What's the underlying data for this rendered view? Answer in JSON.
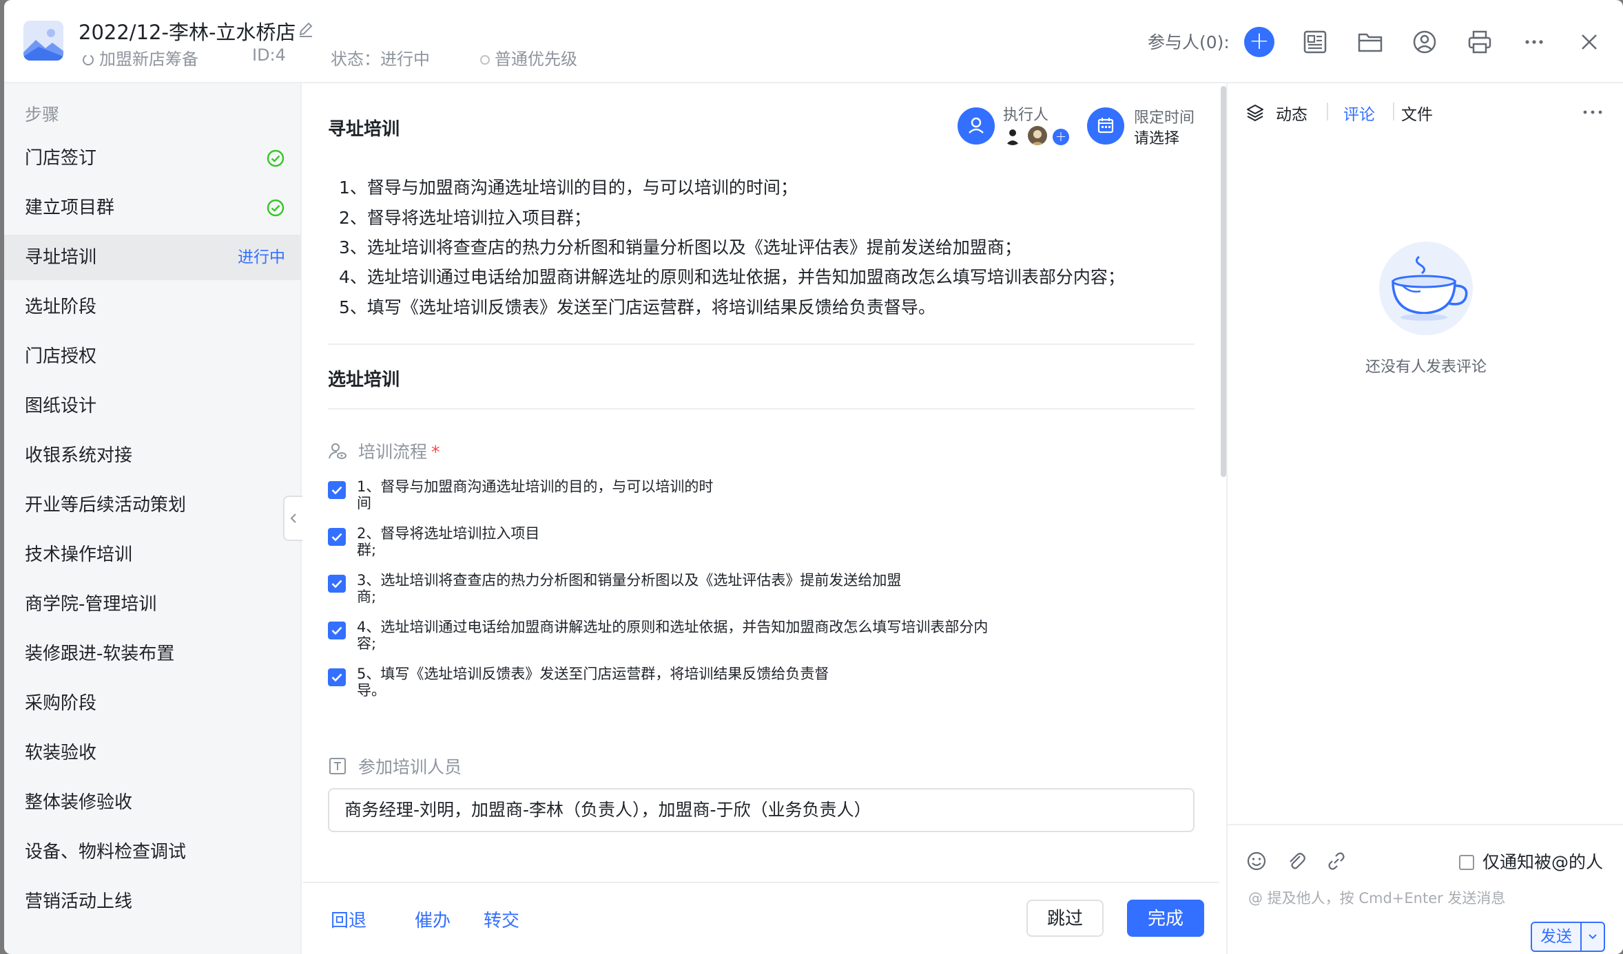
{
  "header": {
    "title": "2022/12-李林-立水桥店",
    "category": "加盟新店筹备",
    "id_text": "ID:4",
    "status_text": "状态：进行中",
    "priority": "普通优先级",
    "participants_label": "参与人(0):"
  },
  "sidebar": {
    "heading": "步骤",
    "steps": [
      {
        "label": "门店签订",
        "done": true
      },
      {
        "label": "建立项目群",
        "done": true
      },
      {
        "label": "寻址培训",
        "status": "进行中"
      },
      {
        "label": "选址阶段"
      },
      {
        "label": "门店授权"
      },
      {
        "label": "图纸设计"
      },
      {
        "label": "收银系统对接"
      },
      {
        "label": "开业等后续活动策划"
      },
      {
        "label": "技术操作培训"
      },
      {
        "label": "商学院-管理培训"
      },
      {
        "label": "装修跟进-软装布置"
      },
      {
        "label": "采购阶段"
      },
      {
        "label": "软装验收"
      },
      {
        "label": "整体装修验收"
      },
      {
        "label": "设备、物料检查调试"
      },
      {
        "label": "营销活动上线"
      }
    ]
  },
  "main": {
    "section1_title": "寻址培训",
    "executor_label": "执行人",
    "deadline_label": "限定时间",
    "deadline_value": "请选择",
    "description": [
      "1、督导与加盟商沟通选址培训的目的，与可以培训的时间；",
      "2、督导将选址培训拉入项目群；",
      "3、选址培训将查查店的热力分析图和销量分析图以及《选址评估表》提前发送给加盟商；",
      "4、选址培训通过电话给加盟商讲解选址的原则和选址依据，并告知加盟商改怎么填写培训表部分内容；",
      "5、填写《选址培训反馈表》发送至门店运营群，将培训结果反馈给负责督导。"
    ],
    "section2_title": "选址培训",
    "field_process_label": "培训流程",
    "required_mark": "*",
    "checklist": [
      {
        "text": "1、督导与加盟商沟通选址培训的目的，与可以培训的时\n间",
        "checked": true
      },
      {
        "text": "2、督导将选址培训拉入项目\n群;",
        "checked": true
      },
      {
        "text": "3、选址培训将查查店的热力分析图和销量分析图以及《选址评估表》提前发送给加盟\n商;",
        "checked": true
      },
      {
        "text": "4、选址培训通过电话给加盟商讲解选址的原则和选址依据，并告知加盟商改怎么填写培训表部分内\n容;",
        "checked": true
      },
      {
        "text": "5、填写《选址培训反馈表》发送至门店运营群，将培训结果反馈给负责督\n导。",
        "checked": true
      }
    ],
    "field_people_label": "参加培训人员",
    "field_people_value": "商务经理-刘明，加盟商-李林（负责人），加盟商-于欣（业务负责人）"
  },
  "footer": {
    "back": "回退",
    "urge": "催办",
    "transfer": "转交",
    "skip": "跳过",
    "complete": "完成"
  },
  "right_panel": {
    "tabs": [
      "动态",
      "评论",
      "文件"
    ],
    "active_tab": "评论",
    "empty_text": "还没有人发表评论",
    "notify_only": "仅通知被@的人",
    "placeholder": "@ 提及他人，按 Cmd+Enter 发送消息",
    "send": "发送"
  },
  "colors": {
    "accent": "#3370ff",
    "success": "#34c724",
    "required": "#f54a45"
  }
}
